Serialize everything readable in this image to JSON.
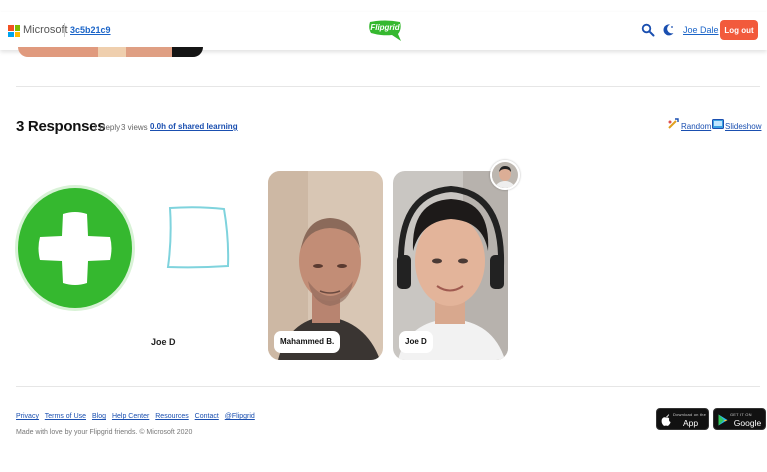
{
  "header": {
    "org_name": "Microsoft",
    "grid_code": "3c5b21c9",
    "brand_name": "Flipgrid",
    "user_name": "Joe Dale",
    "logout_label": "Log out",
    "icons": [
      "search-icon",
      "moon-icon"
    ]
  },
  "responses": {
    "title": "3 Responses",
    "replies": "1 Reply",
    "views": "3 views",
    "shared_learning": "0.0h of shared learning",
    "random_label": "Random",
    "slideshow_label": "Slideshow"
  },
  "cards": [
    {
      "name": "Joe D",
      "kind": "placeholder"
    },
    {
      "name": "Mahammed B.",
      "kind": "video"
    },
    {
      "name": "Joe D",
      "kind": "video"
    }
  ],
  "footer": {
    "links": [
      "Privacy",
      "Terms of Use",
      "Blog",
      "Help Center",
      "Resources",
      "Contact",
      "@Flipgrid"
    ],
    "copyright": "Made with love by your Flipgrid friends. © Microsoft 2020",
    "app_store": {
      "small": "Download on the",
      "big": "App Store"
    },
    "google_play": {
      "small": "GET IT ON",
      "big": "Google Play"
    }
  },
  "colors": {
    "accent_green": "#35b82f",
    "logout_red": "#f25a3c",
    "link_blue": "#1a4fb0",
    "placeholder_outline": "#7fd3dd"
  }
}
